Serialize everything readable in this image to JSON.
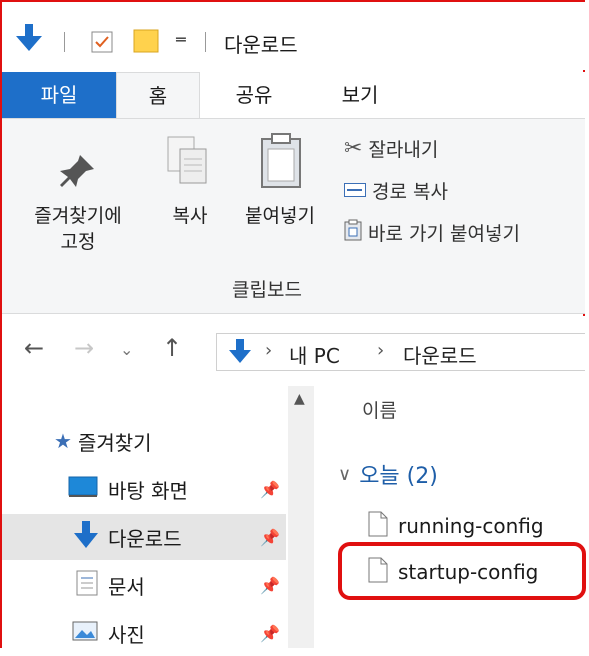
{
  "title": "다운로드",
  "tabs": {
    "file": "파일",
    "home": "홈",
    "share": "공유",
    "view": "보기"
  },
  "ribbon": {
    "pin": "즐겨찾기에\n고정",
    "copy": "복사",
    "paste": "붙여넣기",
    "cut": "잘라내기",
    "copy_path": "경로 복사",
    "paste_shortcut": "바로 가기 붙여넣기",
    "group": "클립보드"
  },
  "address": {
    "root": "내 PC",
    "current": "다운로드"
  },
  "nav_pane": {
    "favorites": "즐겨찾기",
    "items": [
      {
        "label": "바탕 화면",
        "icon": "desktop-icon"
      },
      {
        "label": "다운로드",
        "icon": "download-icon",
        "selected": true
      },
      {
        "label": "문서",
        "icon": "document-icon"
      },
      {
        "label": "사진",
        "icon": "picture-icon"
      }
    ]
  },
  "content": {
    "column_name": "이름",
    "group": "오늘 (2)",
    "files": [
      "running-config",
      "startup-config"
    ]
  },
  "colors": {
    "accent": "#1e6fc9",
    "highlight": "#e01010"
  }
}
